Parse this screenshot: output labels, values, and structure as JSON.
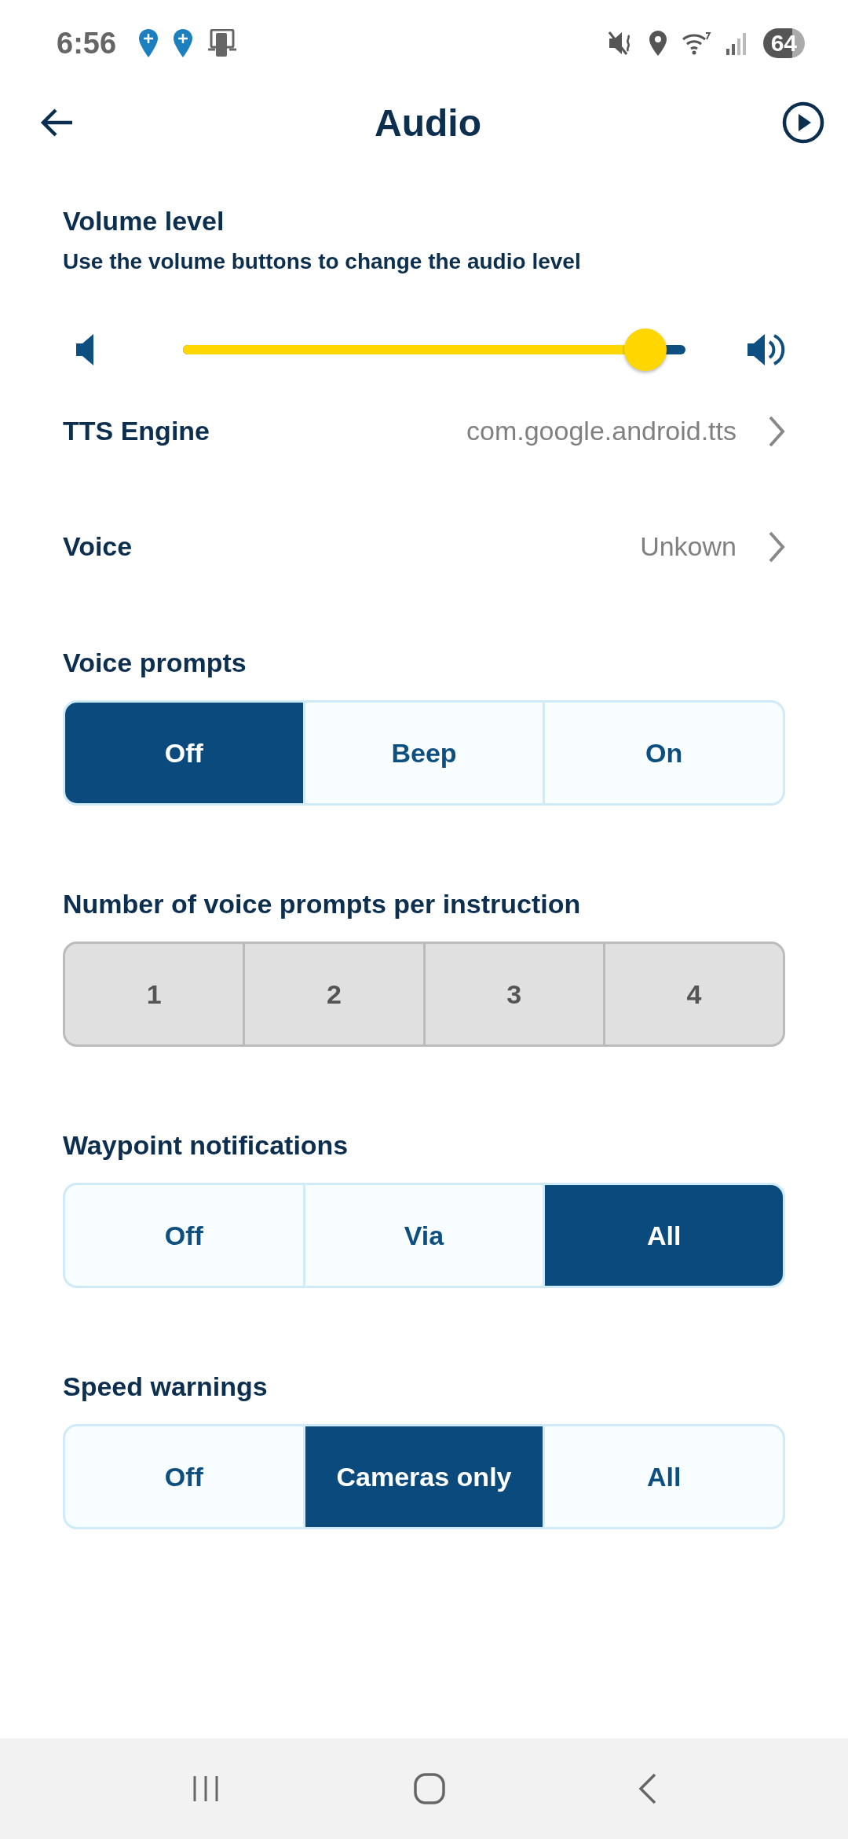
{
  "status_bar": {
    "time": "6:56",
    "battery": "64"
  },
  "header": {
    "title": "Audio"
  },
  "volume": {
    "title": "Volume level",
    "subtitle": "Use the volume buttons to change the audio level",
    "level": 0.92
  },
  "settings": [
    {
      "label": "TTS Engine",
      "value": "com.google.android.tts"
    },
    {
      "label": "Voice",
      "value": "Unkown"
    }
  ],
  "option_groups": [
    {
      "title": "Voice prompts",
      "disabled": false,
      "options": [
        {
          "label": "Off",
          "selected": true
        },
        {
          "label": "Beep",
          "selected": false
        },
        {
          "label": "On",
          "selected": false
        }
      ]
    },
    {
      "title": "Number of voice prompts per instruction",
      "disabled": true,
      "options": [
        {
          "label": "1",
          "selected": false
        },
        {
          "label": "2",
          "selected": false
        },
        {
          "label": "3",
          "selected": false
        },
        {
          "label": "4",
          "selected": false
        }
      ]
    },
    {
      "title": "Waypoint notifications",
      "disabled": false,
      "options": [
        {
          "label": "Off",
          "selected": false
        },
        {
          "label": "Via",
          "selected": false
        },
        {
          "label": "All",
          "selected": true
        }
      ]
    },
    {
      "title": "Speed warnings",
      "disabled": false,
      "options": [
        {
          "label": "Off",
          "selected": false
        },
        {
          "label": "Cameras only",
          "selected": true
        },
        {
          "label": "All",
          "selected": false
        }
      ]
    }
  ]
}
